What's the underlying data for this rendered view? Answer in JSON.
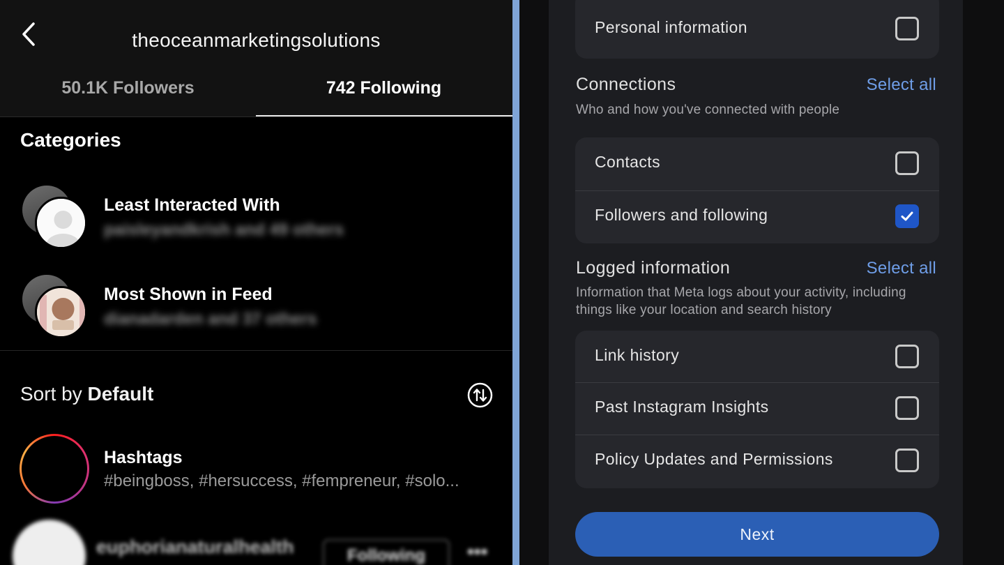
{
  "left": {
    "username": "theoceanmarketingsolutions",
    "tabs": [
      {
        "label": "50.1K Followers"
      },
      {
        "label": "742 Following"
      }
    ],
    "categories_title": "Categories",
    "categories": [
      {
        "name": "Least Interacted With",
        "sub": "paisleyandkrish and 49 others"
      },
      {
        "name": "Most Shown in Feed",
        "sub": "dianadarden and 37 others"
      }
    ],
    "sort": {
      "prefix": "Sort by",
      "value": "Default"
    },
    "hashtags": {
      "name": "Hashtags",
      "sub": "#beingboss, #hersuccess, #fempreneur, #solo..."
    },
    "account": {
      "name": "euphorianaturalhealth",
      "button": "Following",
      "more": "•••"
    }
  },
  "right": {
    "top_option": {
      "label": "Personal information",
      "checked": false
    },
    "connections": {
      "title": "Connections",
      "select_all": "Select all",
      "desc": "Who and how you've connected with people",
      "options": [
        {
          "label": "Contacts",
          "checked": false
        },
        {
          "label": "Followers and following",
          "checked": true
        }
      ]
    },
    "logged": {
      "title": "Logged information",
      "select_all": "Select all",
      "desc": "Information that Meta logs about your activity, including things like your location and search history",
      "options": [
        {
          "label": "Link history",
          "checked": false
        },
        {
          "label": "Past Instagram Insights",
          "checked": false
        },
        {
          "label": "Policy Updates and Permissions",
          "checked": false
        }
      ]
    },
    "next": "Next"
  },
  "colors": {
    "accent": "#2b5fb5",
    "link": "#6f9ee8",
    "checkbox_checked": "#1f56c7",
    "split": "#7fa4d6"
  }
}
